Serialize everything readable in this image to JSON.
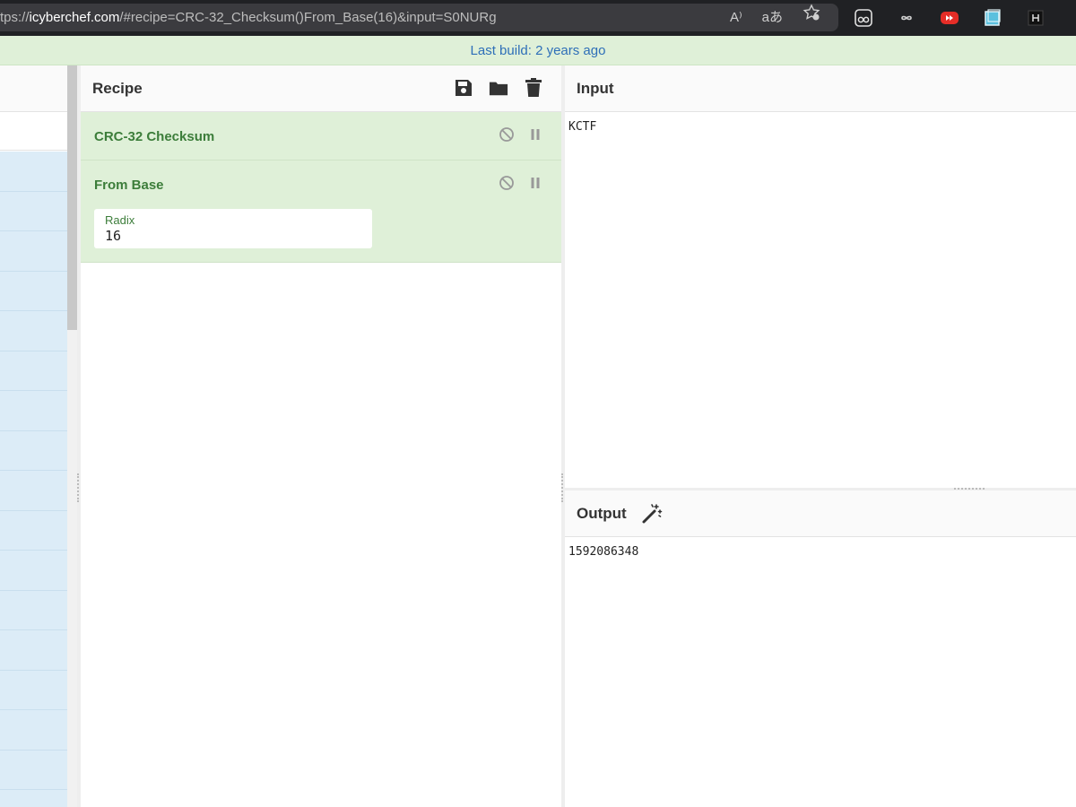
{
  "browser": {
    "url_prefix": "tps://",
    "url_host": "icyberchef.com",
    "url_rest": "/#recipe=CRC-32_Checksum()From_Base(16)&input=S0NURg",
    "read_aloud_text": "A⁾",
    "translate_text": "aあ"
  },
  "banner": {
    "text": "Last build: 2 years ago"
  },
  "recipe": {
    "title": "Recipe",
    "operations": [
      {
        "title": "CRC-32 Checksum"
      },
      {
        "title": "From Base",
        "arg_label": "Radix",
        "arg_value": "16"
      }
    ]
  },
  "input": {
    "title": "Input",
    "text": "KCTF"
  },
  "output": {
    "title": "Output",
    "text": "1592086348"
  },
  "colors": {
    "banner_bg": "#dff0d8",
    "banner_text": "#2e6fb8",
    "op_bg": "#dff0d8",
    "op_title": "#3c7d3a",
    "ops_list_bg": "#dcecf7"
  }
}
